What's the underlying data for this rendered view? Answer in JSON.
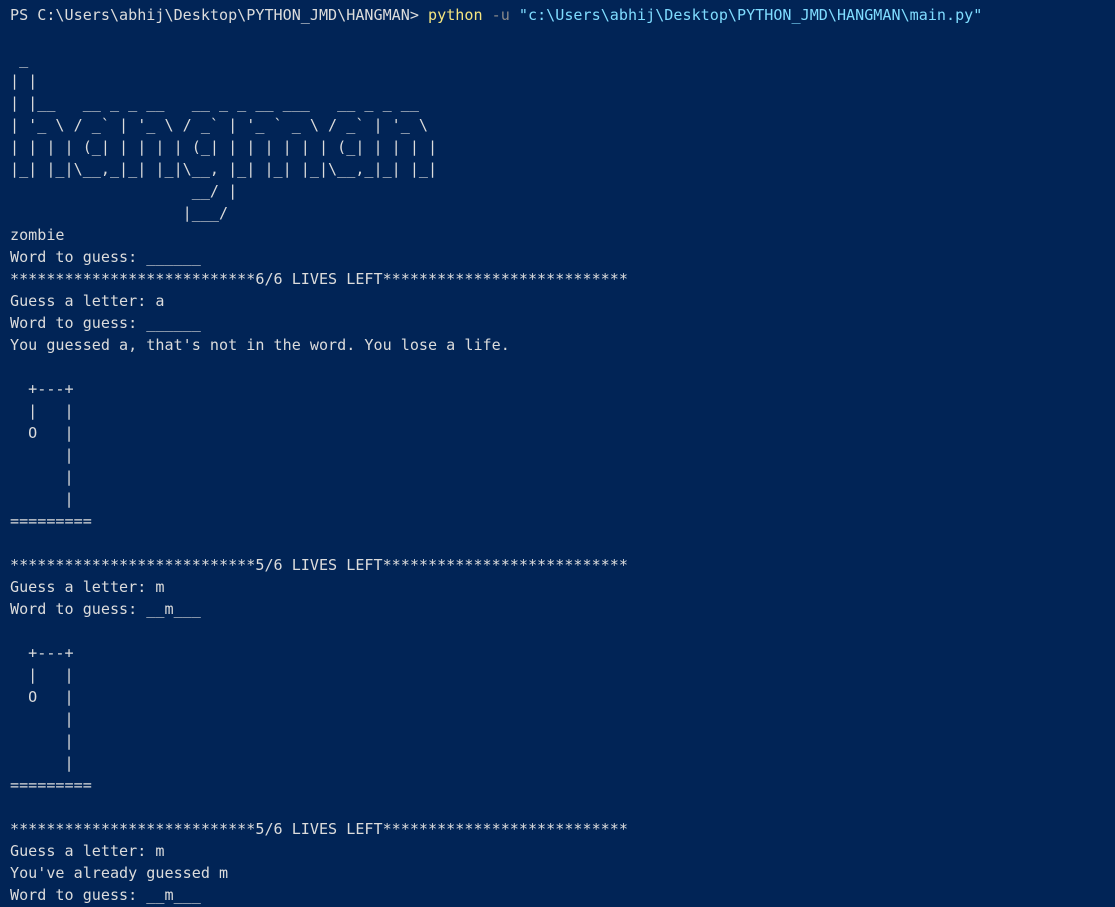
{
  "colors": {
    "background": "#012456",
    "text": "#dcdcdc",
    "command": "#f4e580",
    "flag": "#8a8a8a",
    "string": "#7fdcff"
  },
  "prompt": {
    "path": "PS C:\\Users\\abhij\\Desktop\\PYTHON_JMD\\HANGMAN> ",
    "command": "python",
    "flag": " -u ",
    "argument": "\"c:\\Users\\abhij\\Desktop\\PYTHON_JMD\\HANGMAN\\main.py\""
  },
  "output_lines": [
    "",
    " _",
    "| |",
    "| |__   __ _ _ __   __ _ _ __ ___   __ _ _ __",
    "| '_ \\ / _` | '_ \\ / _` | '_ ` _ \\ / _` | '_ \\",
    "| | | | (_| | | | | (_| | | | | | | (_| | | | |",
    "|_| |_|\\__,_|_| |_|\\__, |_| |_| |_|\\__,_|_| |_|",
    "                    __/ |",
    "                   |___/",
    "zombie",
    "Word to guess: ______",
    "***************************6/6 LIVES LEFT***************************",
    "Guess a letter: a",
    "Word to guess: ______",
    "You guessed a, that's not in the word. You lose a life.",
    "",
    "  +---+",
    "  |   |",
    "  O   |",
    "      |",
    "      |",
    "      |",
    "=========",
    "",
    "***************************5/6 LIVES LEFT***************************",
    "Guess a letter: m",
    "Word to guess: __m___",
    "",
    "  +---+",
    "  |   |",
    "  O   |",
    "      |",
    "      |",
    "      |",
    "=========",
    "",
    "***************************5/6 LIVES LEFT***************************",
    "Guess a letter: m",
    "You've already guessed m",
    "Word to guess: __m___"
  ]
}
